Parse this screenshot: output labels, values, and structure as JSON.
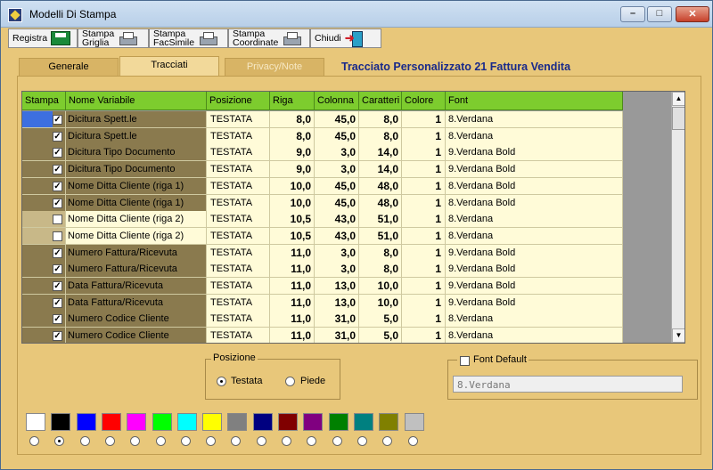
{
  "window": {
    "title": "Modelli Di Stampa",
    "min": "–",
    "max": "□",
    "close": "✕"
  },
  "toolbar": [
    {
      "label": "Registra",
      "icon": "save-icon"
    },
    {
      "label": "Stampa\nGriglia",
      "icon": "printer-icon"
    },
    {
      "label": "Stampa\nFacSimile",
      "icon": "printer-icon"
    },
    {
      "label": "Stampa\nCoordinate",
      "icon": "printer-icon"
    },
    {
      "label": "Chiudi",
      "icon": "exit-icon"
    }
  ],
  "tabs": {
    "generale": "Generale",
    "tracciati": "Tracciati",
    "privacy": "Privacy/Note"
  },
  "headline": "Tracciato Personalizzato 21  Fattura Vendita",
  "grid": {
    "columns": [
      "Stampa",
      "Nome Variabile",
      "Posizione",
      "Riga",
      "Colonna",
      "Caratteri",
      "Colore",
      "Font"
    ],
    "rows": [
      {
        "checked": true,
        "name": "Dicitura Spett.le",
        "pos": "TESTATA",
        "riga": "8,0",
        "col": "45,0",
        "car": "8,0",
        "color": "1",
        "font": "8.Verdana"
      },
      {
        "checked": true,
        "name": "Dicitura Spett.le",
        "pos": "TESTATA",
        "riga": "8,0",
        "col": "45,0",
        "car": "8,0",
        "color": "1",
        "font": "8.Verdana"
      },
      {
        "checked": true,
        "name": "Dicitura Tipo Documento",
        "pos": "TESTATA",
        "riga": "9,0",
        "col": "3,0",
        "car": "14,0",
        "color": "1",
        "font": "9.Verdana Bold"
      },
      {
        "checked": true,
        "name": "Dicitura Tipo Documento",
        "pos": "TESTATA",
        "riga": "9,0",
        "col": "3,0",
        "car": "14,0",
        "color": "1",
        "font": "9.Verdana Bold"
      },
      {
        "checked": true,
        "name": "Nome Ditta Cliente (riga 1)",
        "pos": "TESTATA",
        "riga": "10,0",
        "col": "45,0",
        "car": "48,0",
        "color": "1",
        "font": "8.Verdana Bold"
      },
      {
        "checked": true,
        "name": "Nome Ditta Cliente (riga 1)",
        "pos": "TESTATA",
        "riga": "10,0",
        "col": "45,0",
        "car": "48,0",
        "color": "1",
        "font": "8.Verdana Bold"
      },
      {
        "checked": false,
        "name": "Nome Ditta Cliente (riga 2)",
        "pos": "TESTATA",
        "riga": "10,5",
        "col": "43,0",
        "car": "51,0",
        "color": "1",
        "font": "8.Verdana"
      },
      {
        "checked": false,
        "name": "Nome Ditta Cliente (riga 2)",
        "pos": "TESTATA",
        "riga": "10,5",
        "col": "43,0",
        "car": "51,0",
        "color": "1",
        "font": "8.Verdana"
      },
      {
        "checked": true,
        "name": "Numero Fattura/Ricevuta",
        "pos": "TESTATA",
        "riga": "11,0",
        "col": "3,0",
        "car": "8,0",
        "color": "1",
        "font": "9.Verdana Bold"
      },
      {
        "checked": true,
        "name": "Numero Fattura/Ricevuta",
        "pos": "TESTATA",
        "riga": "11,0",
        "col": "3,0",
        "car": "8,0",
        "color": "1",
        "font": "9.Verdana Bold"
      },
      {
        "checked": true,
        "name": "Data Fattura/Ricevuta",
        "pos": "TESTATA",
        "riga": "11,0",
        "col": "13,0",
        "car": "10,0",
        "color": "1",
        "font": "9.Verdana Bold"
      },
      {
        "checked": true,
        "name": "Data Fattura/Ricevuta",
        "pos": "TESTATA",
        "riga": "11,0",
        "col": "13,0",
        "car": "10,0",
        "color": "1",
        "font": "9.Verdana Bold"
      },
      {
        "checked": true,
        "name": "Numero Codice Cliente",
        "pos": "TESTATA",
        "riga": "11,0",
        "col": "31,0",
        "car": "5,0",
        "color": "1",
        "font": "8.Verdana"
      },
      {
        "checked": true,
        "name": "Numero Codice Cliente",
        "pos": "TESTATA",
        "riga": "11,0",
        "col": "31,0",
        "car": "5,0",
        "color": "1",
        "font": "8.Verdana"
      }
    ]
  },
  "posizione": {
    "title": "Posizione",
    "testata": "Testata",
    "piede": "Piede",
    "selected": "testata"
  },
  "fontDefault": {
    "label": "Font Default",
    "checked": false,
    "value": "8.Verdana"
  },
  "palette": {
    "colors": [
      "#ffffff",
      "#000000",
      "#0000ff",
      "#ff0000",
      "#ff00ff",
      "#00ff00",
      "#00ffff",
      "#ffff00",
      "#808080",
      "#000080",
      "#800000",
      "#800080",
      "#008000",
      "#008080",
      "#808000",
      "#c0c0c0"
    ],
    "selected": 1
  }
}
